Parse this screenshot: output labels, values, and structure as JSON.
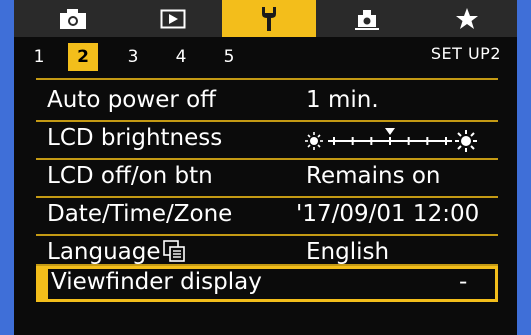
{
  "tabs": [
    {
      "icon": "camera-icon",
      "active": false
    },
    {
      "icon": "playback-icon",
      "active": false
    },
    {
      "icon": "wrench-icon",
      "active": true
    },
    {
      "icon": "custom-function-icon",
      "active": false
    },
    {
      "icon": "star-icon",
      "active": false
    }
  ],
  "subtabs": [
    "1",
    "2",
    "3",
    "4",
    "5"
  ],
  "active_subtab": "2",
  "menu_label": "SET UP2",
  "rows": [
    {
      "label": "Auto power off",
      "value": "1 min."
    },
    {
      "label": "LCD brightness",
      "value": "",
      "slider_level": 4,
      "slider_steps": 7
    },
    {
      "label": "LCD off/on btn",
      "value": "Remains on"
    },
    {
      "label": "Date/Time/Zone",
      "value": "'17/09/01 12:00"
    },
    {
      "label": "Language",
      "value": "English",
      "icon": "language-icon"
    },
    {
      "label": "Viewfinder display",
      "value": "-",
      "selected": true
    }
  ],
  "colors": {
    "accent": "#f3be1b",
    "background": "#0b0b0b",
    "tabbar": "#2a2a2a",
    "outer": "#3f6fd8"
  }
}
